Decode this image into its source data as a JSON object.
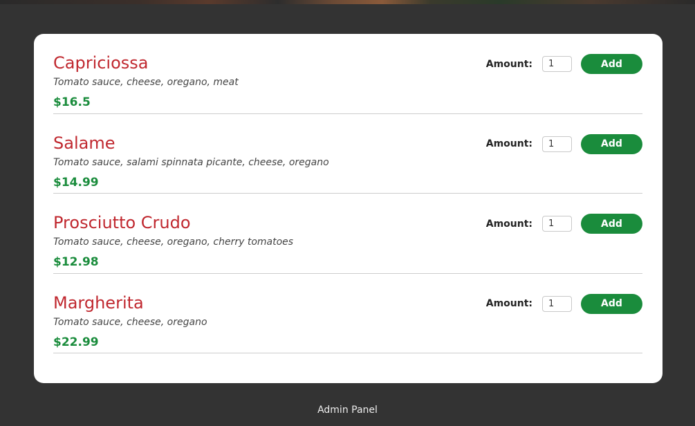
{
  "amount_label": "Amount:",
  "add_label": "Add",
  "footer": {
    "admin_link": "Admin Panel"
  },
  "meals": [
    {
      "name": "Capriciossa",
      "description": "Tomato sauce, cheese, oregano, meat",
      "price": "$16.5",
      "amount": "1"
    },
    {
      "name": "Salame",
      "description": "Tomato sauce, salami spinnata picante, cheese, oregano",
      "price": "$14.99",
      "amount": "1"
    },
    {
      "name": "Prosciutto Crudo",
      "description": "Tomato sauce, cheese, oregano, cherry tomatoes",
      "price": "$12.98",
      "amount": "1"
    },
    {
      "name": "Margherita",
      "description": "Tomato sauce, cheese, oregano",
      "price": "$22.99",
      "amount": "1"
    }
  ],
  "colors": {
    "page_background": "#333333",
    "meal_name": "#c0282f",
    "price": "#1a8c3c",
    "add_button": "#1a8c3c"
  }
}
